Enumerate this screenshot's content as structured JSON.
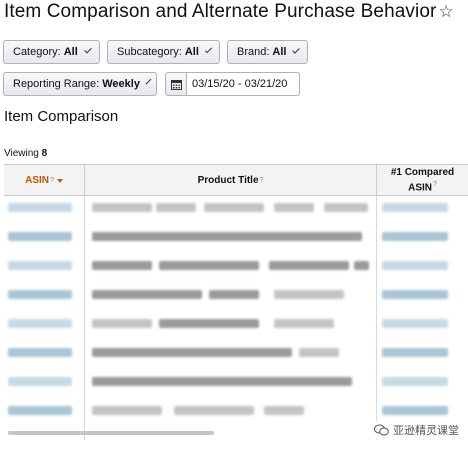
{
  "page": {
    "title": "Item Comparison and Alternate Purchase Behavior",
    "favorite_icon": "star-outline-icon"
  },
  "filters": {
    "category": {
      "label": "Category:",
      "value": "All"
    },
    "subcategory": {
      "label": "Subcategory:",
      "value": "All"
    },
    "brand": {
      "label": "Brand:",
      "value": "All"
    },
    "reporting_range": {
      "label": "Reporting Range:",
      "value": "Weekly"
    },
    "date_range": "03/15/20 - 03/21/20"
  },
  "section": {
    "title": "Item Comparison"
  },
  "viewing": {
    "label": "Viewing",
    "count": "8"
  },
  "table": {
    "columns": [
      {
        "label": "ASIN",
        "sup": "?"
      },
      {
        "label": "Product Title",
        "sup": "?"
      },
      {
        "label": "#1 Compared ASIN",
        "sup": "?"
      }
    ],
    "sort_column": "ASIN",
    "rows_visible": 8
  },
  "watermark": {
    "text": "亚逊精灵课堂"
  },
  "colors": {
    "accent": "#c45500",
    "blurred_link": "#a9c6d6"
  }
}
